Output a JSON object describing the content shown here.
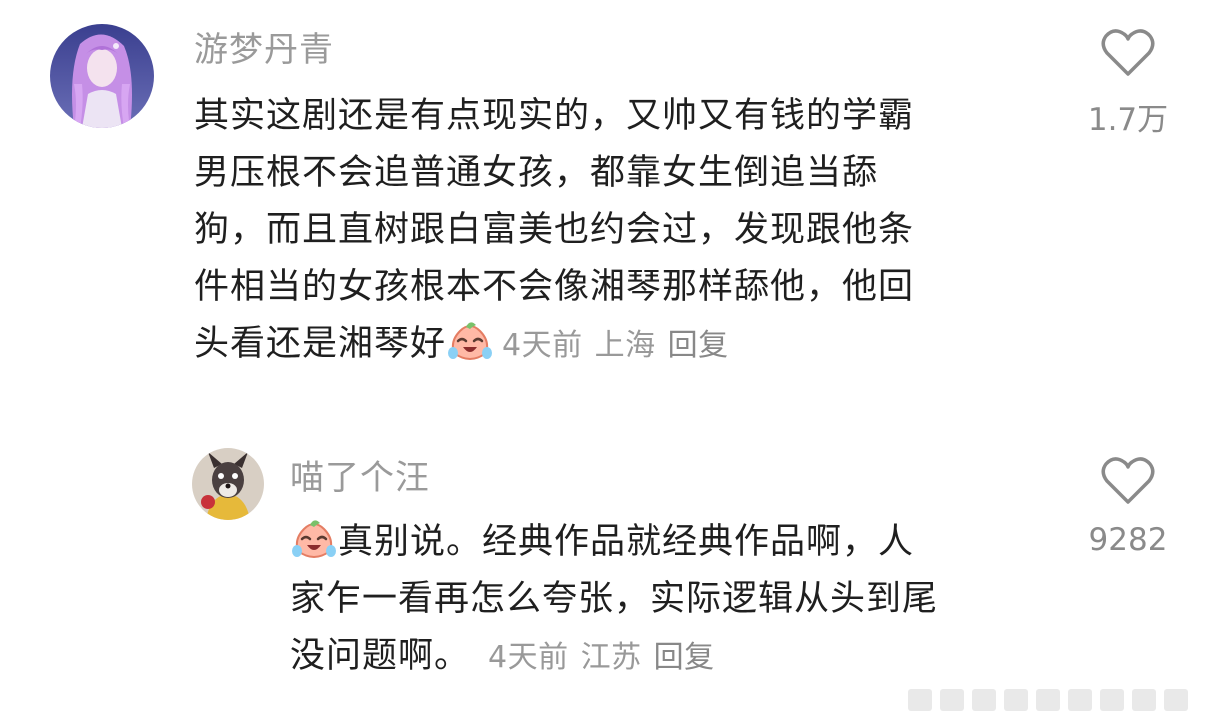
{
  "comments": [
    {
      "username": "游梦丹青",
      "lines": [
        "其实这剧还是有点现实的，又帅又有钱的学霸",
        "男压根不会追普通女孩，都靠女生倒追当舔",
        "狗，而且直树跟白富美也约会过，发现跟他条",
        "件相当的女孩根本不会像湘琴那样舔他，他回",
        "头看还是湘琴好"
      ],
      "trailing_emoji": "crying-laughing-emoji",
      "time": "4天前",
      "location": "上海",
      "reply_label": "回复",
      "like_count": "1.7万"
    },
    {
      "username": "喵了个汪",
      "leading_emoji": "crying-laughing-emoji",
      "lines": [
        "真别说。经典作品就经典作品啊，人",
        "家乍一看再怎么夸张，实际逻辑从头到尾",
        "没问题啊。"
      ],
      "time": "4天前",
      "location": "江苏",
      "reply_label": "回复",
      "like_count": "9282"
    }
  ],
  "colors": {
    "username": "#9a9a9a",
    "text": "#1f1f1f",
    "meta": "#999999",
    "icon": "#8a8a8a"
  }
}
